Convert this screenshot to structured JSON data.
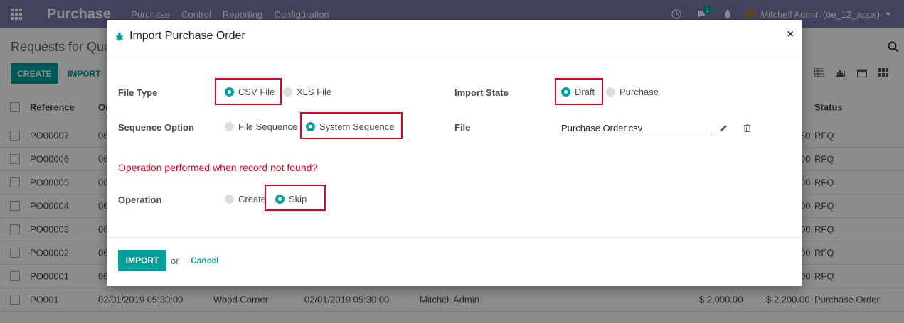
{
  "navbar": {
    "app_name": "Purchase",
    "menu": [
      "Purchase",
      "Control",
      "Reporting",
      "Configuration"
    ],
    "chat_badge": "1",
    "user": "Mitchell Admin (oe_12_apps)"
  },
  "control_panel": {
    "title": "Requests for Quo",
    "create_label": "CREATE",
    "import_label": "IMPORT"
  },
  "list": {
    "headers": {
      "reference": "Reference",
      "order_date_partial": "Or",
      "status": "Status"
    },
    "rows": [
      {
        "reference": "PO00007",
        "date_partial": "06",
        "total_partial": "50",
        "status": "RFQ"
      },
      {
        "reference": "PO00006",
        "date_partial": "06",
        "total_partial": "00",
        "status": "RFQ"
      },
      {
        "reference": "PO00005",
        "date_partial": "06",
        "total_partial": "00",
        "status": "RFQ"
      },
      {
        "reference": "PO00004",
        "date_partial": "06",
        "total_partial": "00",
        "status": "RFQ"
      },
      {
        "reference": "PO00003",
        "date_partial": "06",
        "total_partial": "00",
        "status": "RFQ"
      },
      {
        "reference": "PO00002",
        "date_partial": "06",
        "total_partial": "00",
        "status": "RFQ"
      },
      {
        "reference": "PO00001",
        "date_partial": "06",
        "total_partial": "00",
        "status": "RFQ"
      }
    ],
    "last_row": {
      "reference": "PO001",
      "order_date": "02/01/2019 05:30:00",
      "vendor": "Wood Corner",
      "scheduled_date": "02/01/2019 05:30:00",
      "purchase_rep": "Mitchell Admin",
      "untaxed": "$ 2,000.00",
      "total": "$ 2,200.00",
      "status": "Purchase Order"
    }
  },
  "modal": {
    "title": "Import Purchase Order",
    "file_type_label": "File Type",
    "file_type_options": [
      "CSV File",
      "XLS File"
    ],
    "file_type_selected": "CSV File",
    "import_state_label": "Import State",
    "import_state_options": [
      "Draft",
      "Purchase"
    ],
    "import_state_selected": "Draft",
    "sequence_label": "Sequence Option",
    "sequence_options": [
      "File Sequence",
      "System Sequence"
    ],
    "sequence_selected": "System Sequence",
    "file_label": "File",
    "file_value": "Purchase Order.csv",
    "warning": "Operation performed when record not found?",
    "operation_label": "Operation",
    "operation_options": [
      "Create",
      "Skip"
    ],
    "operation_selected": "Skip",
    "import_button": "IMPORT",
    "or_text": "or",
    "cancel": "Cancel"
  },
  "colors": {
    "navbar": "#7c7bad",
    "accent": "#00a09d",
    "highlight": "#e0001b"
  }
}
